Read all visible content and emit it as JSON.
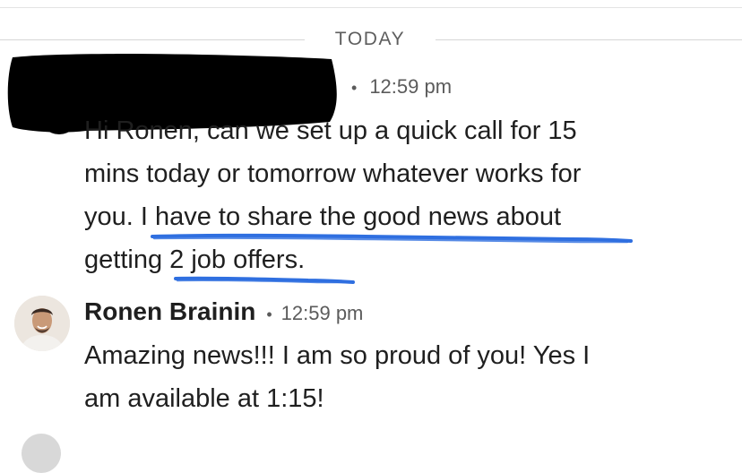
{
  "divider": {
    "label": "TODAY"
  },
  "message1": {
    "sender": "[redacted]",
    "time": "12:59 pm",
    "lines": [
      "Hi Ronen, can we set up a quick call for 15",
      "mins today or tomorrow whatever works for",
      "you. I have to share the good news about",
      "getting 2 job offers."
    ],
    "highlights": [
      "have to share the good news about",
      "2 job offers."
    ],
    "highlight_color": "#2f6fe0"
  },
  "message2": {
    "sender": "Ronen Brainin",
    "time": "12:59 pm",
    "lines": [
      "Amazing news!!! I am so proud of you! Yes I",
      "am available at 1:15!"
    ],
    "avatar_icon": "user-photo"
  },
  "colors": {
    "text": "#1f1f1f",
    "meta": "#5b5b5b",
    "divider": "#d6d6d6",
    "redaction": "#000000"
  }
}
